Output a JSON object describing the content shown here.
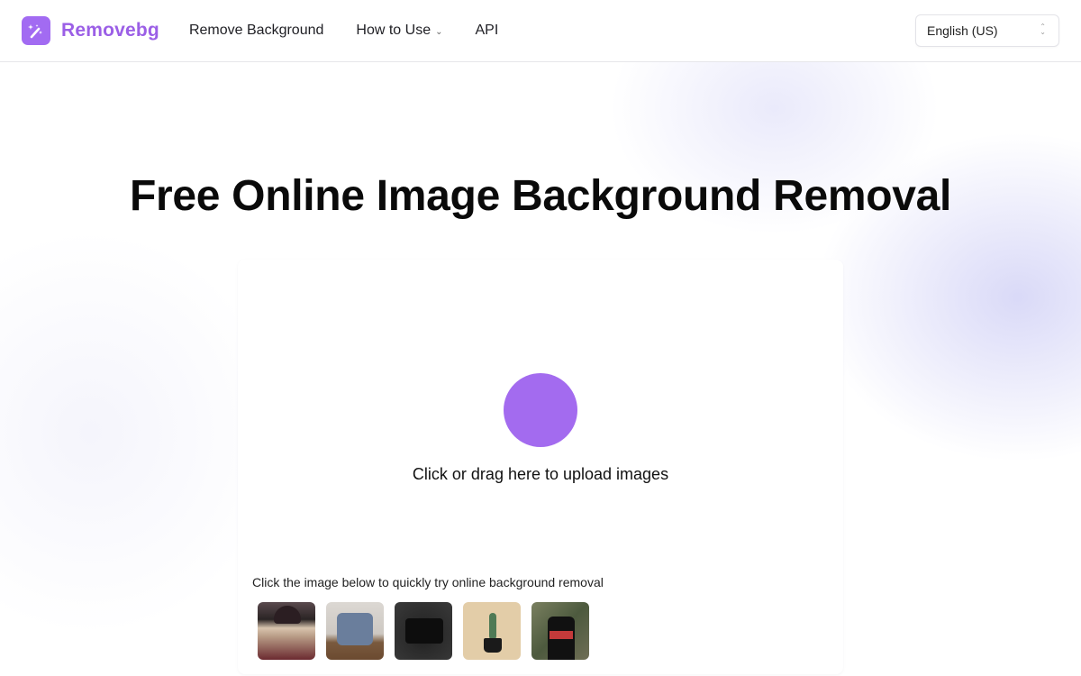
{
  "header": {
    "brand": "Removebg",
    "nav": [
      {
        "label": "Remove Background",
        "has_dropdown": false
      },
      {
        "label": "How to Use",
        "has_dropdown": true
      },
      {
        "label": "API",
        "has_dropdown": false
      }
    ],
    "language": {
      "selected": "English (US)"
    }
  },
  "main": {
    "title": "Free Online Image Background Removal",
    "upload": {
      "prompt": "Click or drag here to upload images",
      "accent_color": "#a36bef"
    },
    "samples": {
      "label": "Click the image below to quickly try online background removal",
      "images": [
        {
          "alt": "woman in beanie"
        },
        {
          "alt": "blue armchair"
        },
        {
          "alt": "black camera"
        },
        {
          "alt": "cactus in pot"
        },
        {
          "alt": "man in hoodie"
        }
      ]
    }
  },
  "colors": {
    "brand": "#9b5fe6",
    "logo_bg": "#a26bf2"
  }
}
